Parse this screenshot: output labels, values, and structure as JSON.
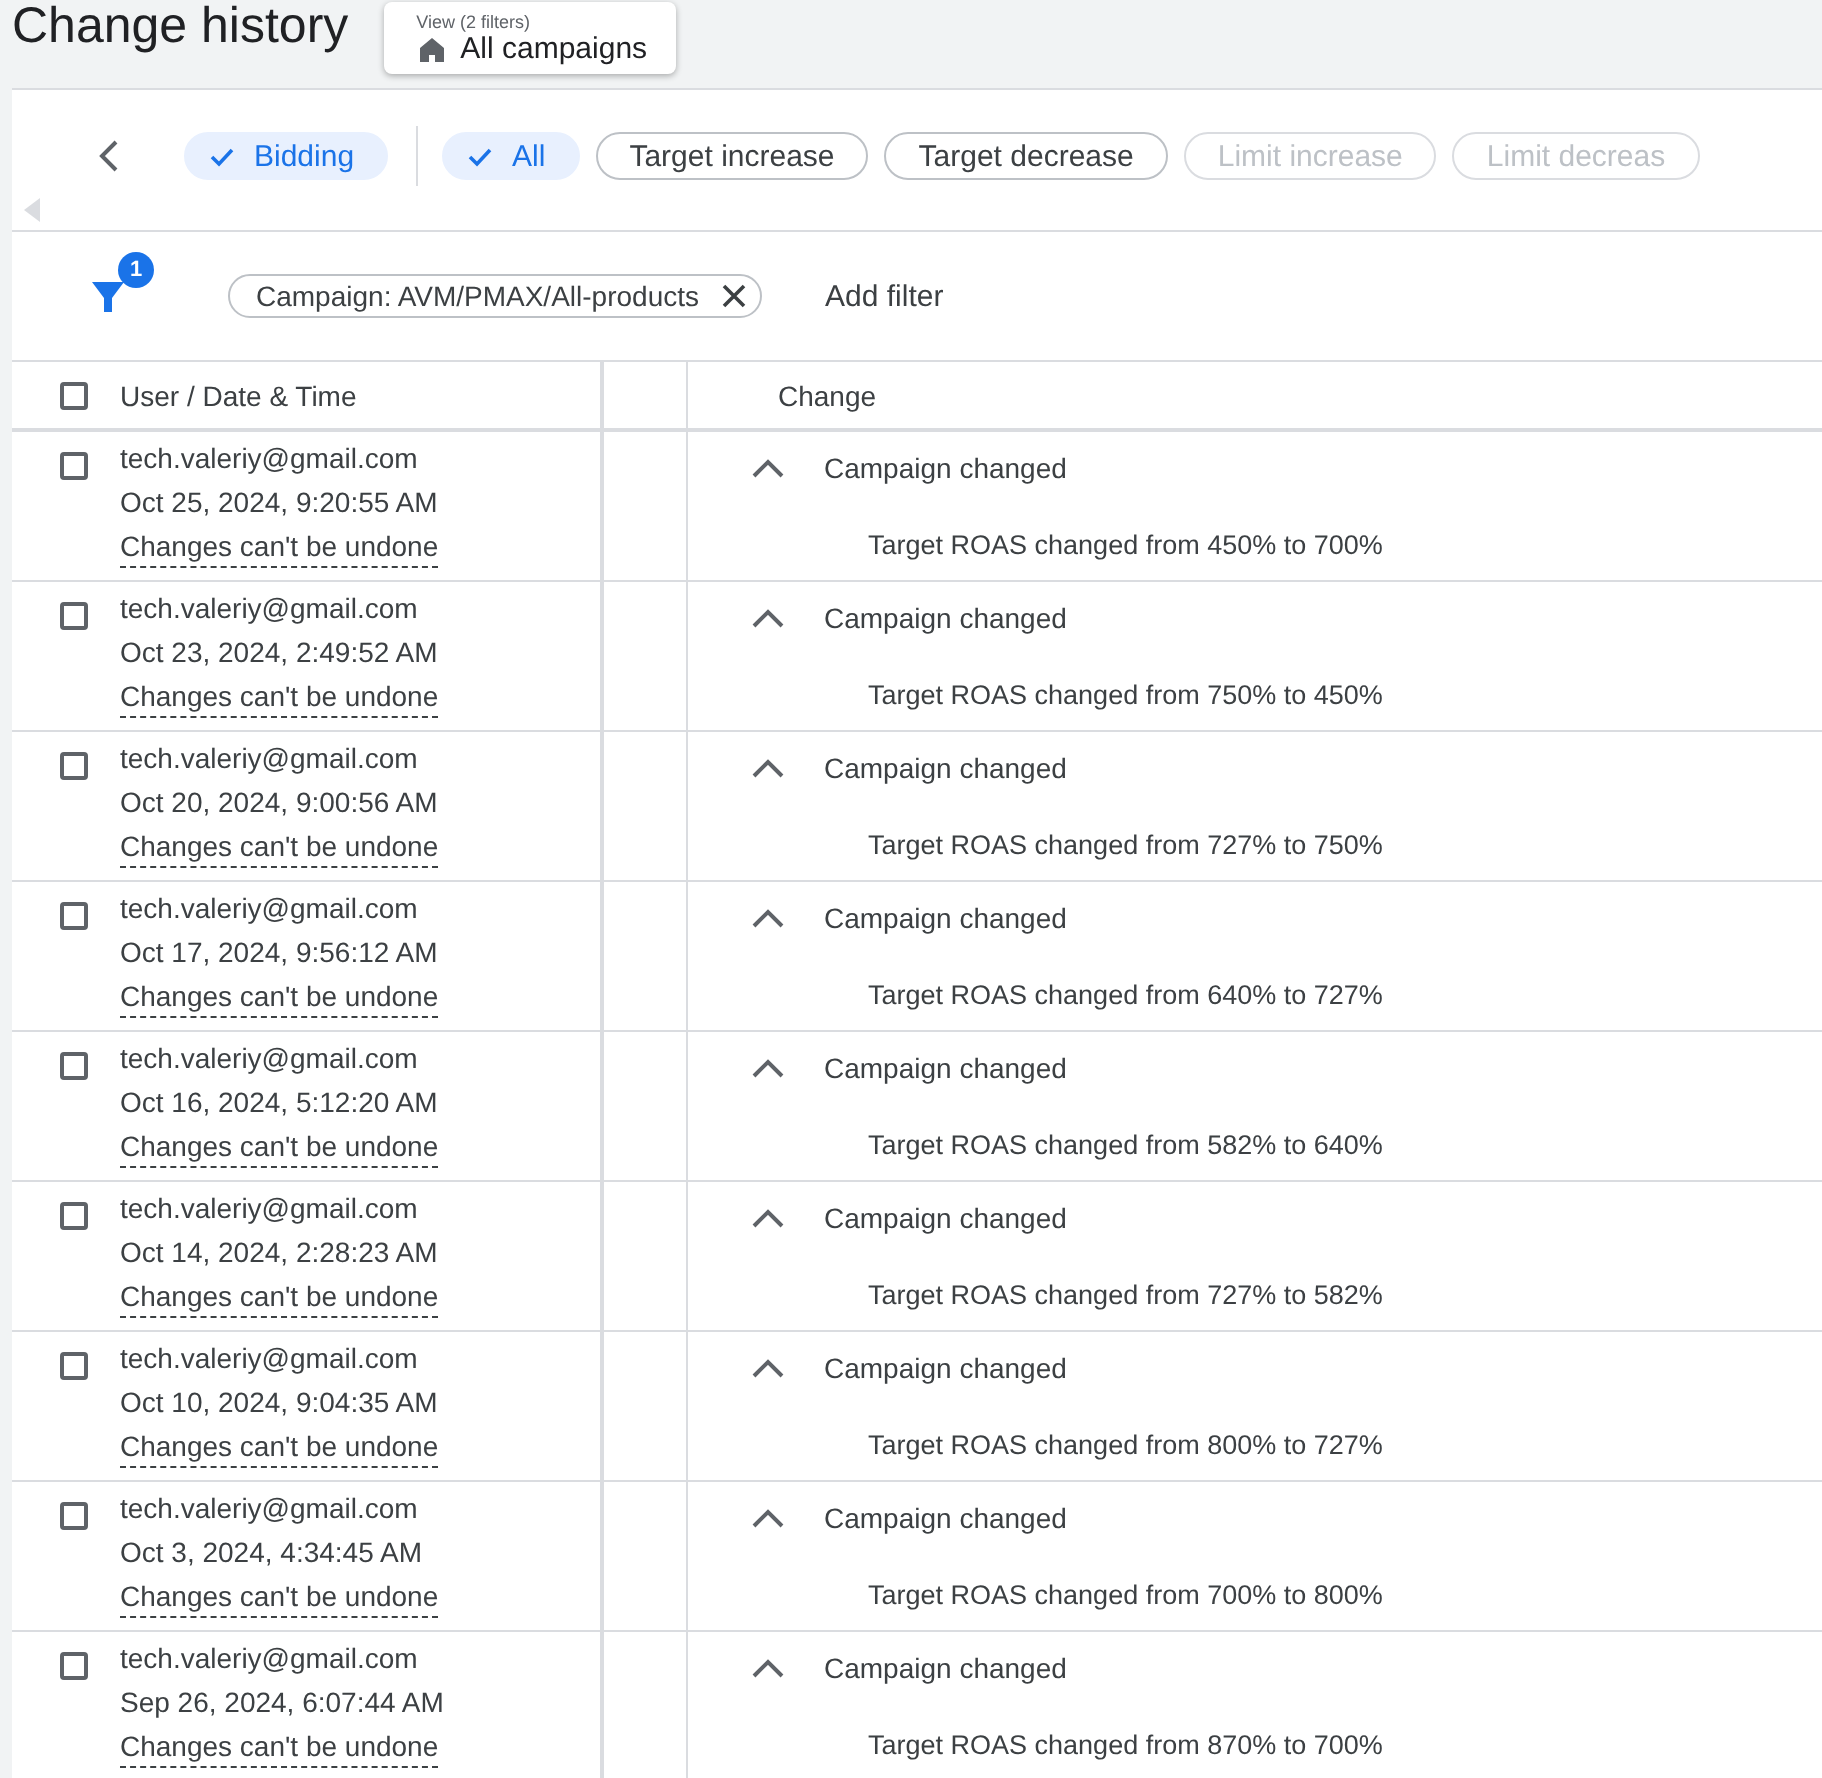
{
  "page_title": "Change history",
  "view_selector": {
    "label": "View (2 filters)",
    "value": "All campaigns"
  },
  "category_chips": [
    {
      "label": "Bidding",
      "selected": true,
      "disabled": false
    }
  ],
  "type_chips": [
    {
      "label": "All",
      "selected": true,
      "disabled": false
    },
    {
      "label": "Target increase",
      "selected": false,
      "disabled": false
    },
    {
      "label": "Target decrease",
      "selected": false,
      "disabled": false
    },
    {
      "label": "Limit increase",
      "selected": false,
      "disabled": true
    },
    {
      "label": "Limit decreas",
      "selected": false,
      "disabled": true
    }
  ],
  "filter": {
    "badge": "1",
    "chips": [
      {
        "label": "Campaign: AVM/PMAX/All-products"
      }
    ],
    "add_label": "Add filter"
  },
  "table": {
    "select_all_checked": false,
    "columns": [
      "User / Date & Time",
      "Change"
    ],
    "rows": [
      {
        "checked": false,
        "user": "tech.valeriy@gmail.com",
        "datetime": "Oct 25, 2024, 9:20:55 AM",
        "note": "Changes can't be undone",
        "expanded": true,
        "change": "Campaign changed",
        "detail": "Target ROAS changed from 450% to 700%"
      },
      {
        "checked": false,
        "user": "tech.valeriy@gmail.com",
        "datetime": "Oct 23, 2024, 2:49:52 AM",
        "note": "Changes can't be undone",
        "expanded": true,
        "change": "Campaign changed",
        "detail": "Target ROAS changed from 750% to 450%"
      },
      {
        "checked": false,
        "user": "tech.valeriy@gmail.com",
        "datetime": "Oct 20, 2024, 9:00:56 AM",
        "note": "Changes can't be undone",
        "expanded": true,
        "change": "Campaign changed",
        "detail": "Target ROAS changed from 727% to 750%"
      },
      {
        "checked": false,
        "user": "tech.valeriy@gmail.com",
        "datetime": "Oct 17, 2024, 9:56:12 AM",
        "note": "Changes can't be undone",
        "expanded": true,
        "change": "Campaign changed",
        "detail": "Target ROAS changed from 640% to 727%"
      },
      {
        "checked": false,
        "user": "tech.valeriy@gmail.com",
        "datetime": "Oct 16, 2024, 5:12:20 AM",
        "note": "Changes can't be undone",
        "expanded": true,
        "change": "Campaign changed",
        "detail": "Target ROAS changed from 582% to 640%"
      },
      {
        "checked": false,
        "user": "tech.valeriy@gmail.com",
        "datetime": "Oct 14, 2024, 2:28:23 AM",
        "note": "Changes can't be undone",
        "expanded": true,
        "change": "Campaign changed",
        "detail": "Target ROAS changed from 727% to 582%"
      },
      {
        "checked": false,
        "user": "tech.valeriy@gmail.com",
        "datetime": "Oct 10, 2024, 9:04:35 AM",
        "note": "Changes can't be undone",
        "expanded": true,
        "change": "Campaign changed",
        "detail": "Target ROAS changed from 800% to 727%"
      },
      {
        "checked": false,
        "user": "tech.valeriy@gmail.com",
        "datetime": "Oct 3, 2024, 4:34:45 AM",
        "note": "Changes can't be undone",
        "expanded": true,
        "change": "Campaign changed",
        "detail": "Target ROAS changed from 700% to 800%"
      },
      {
        "checked": false,
        "user": "tech.valeriy@gmail.com",
        "datetime": "Sep 26, 2024, 6:07:44 AM",
        "note": "Changes can't be undone",
        "expanded": true,
        "change": "Campaign changed",
        "detail": "Target ROAS changed from 870% to 700%"
      }
    ]
  }
}
